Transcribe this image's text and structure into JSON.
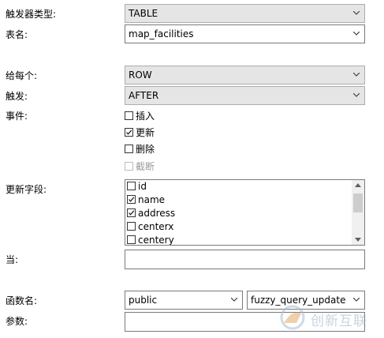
{
  "form": {
    "trigger_type": {
      "label": "触发器类型:",
      "value": "TABLE"
    },
    "table_name": {
      "label": "表名:",
      "value": "map_facilities"
    },
    "for_each": {
      "label": "给每个:",
      "value": "ROW"
    },
    "fire": {
      "label": "触发:",
      "value": "AFTER"
    },
    "events": {
      "label": "事件:",
      "items": [
        {
          "label": "插入",
          "checked": false,
          "enabled": true
        },
        {
          "label": "更新",
          "checked": true,
          "enabled": true
        },
        {
          "label": "删除",
          "checked": false,
          "enabled": true
        },
        {
          "label": "截断",
          "checked": false,
          "enabled": false
        }
      ]
    },
    "update_fields": {
      "label": "更新字段:",
      "items": [
        {
          "label": "id",
          "checked": false
        },
        {
          "label": "name",
          "checked": true
        },
        {
          "label": "address",
          "checked": true
        },
        {
          "label": "centerx",
          "checked": false
        },
        {
          "label": "centery",
          "checked": false
        }
      ]
    },
    "when": {
      "label": "当:",
      "value": ""
    },
    "function_name": {
      "label": "函数名:",
      "schema": "public",
      "function": "fuzzy_query_update"
    },
    "params": {
      "label": "参数:",
      "value": ""
    }
  },
  "watermark": {
    "text": "创新互联"
  }
}
